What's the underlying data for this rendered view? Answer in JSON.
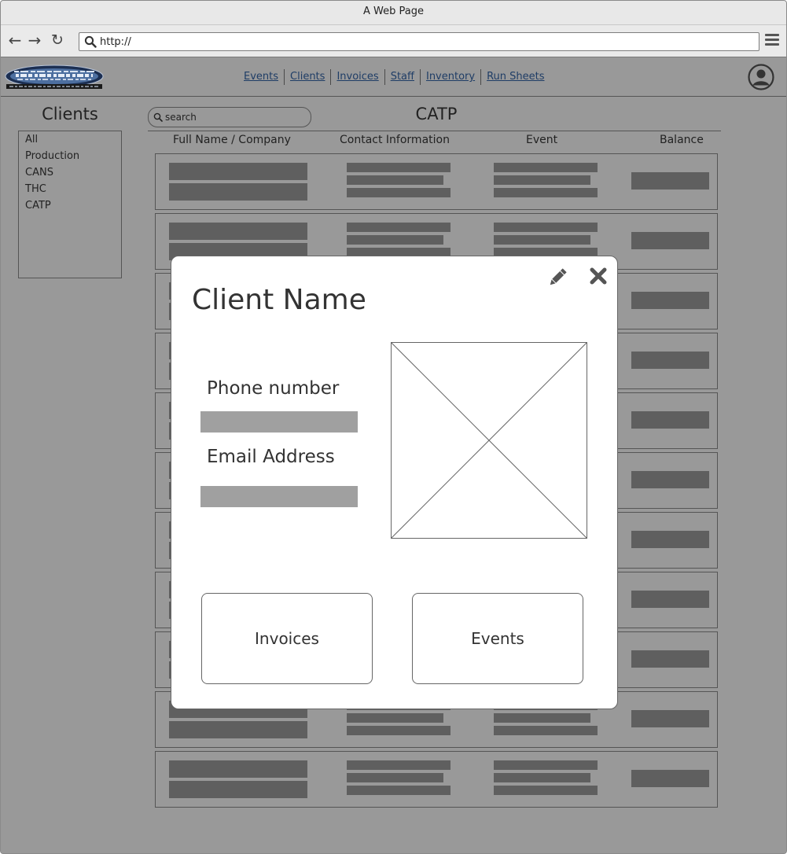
{
  "browser": {
    "title": "A Web Page",
    "url": "http://"
  },
  "nav": {
    "items": [
      "Events",
      "Clients",
      "Invoices",
      "Staff",
      "Inventory",
      "Run Sheets"
    ]
  },
  "sidebar": {
    "title": "Clients",
    "items": [
      "All",
      "Production",
      "CANS",
      "THC",
      "CATP"
    ]
  },
  "search": {
    "placeholder": "search"
  },
  "main": {
    "title": "CATP",
    "columns": [
      "Full Name / Company",
      "Contact Information",
      "Event",
      "Balance"
    ]
  },
  "modal": {
    "client_name": "Client Name",
    "phone_label": "Phone number",
    "email_label": "Email Address",
    "invoices_button": "Invoices",
    "events_button": "Events"
  },
  "icons": {
    "edit": "pencil-icon",
    "close": "close-icon",
    "user": "user-icon",
    "search": "search-icon",
    "menu": "hamburger-icon"
  }
}
